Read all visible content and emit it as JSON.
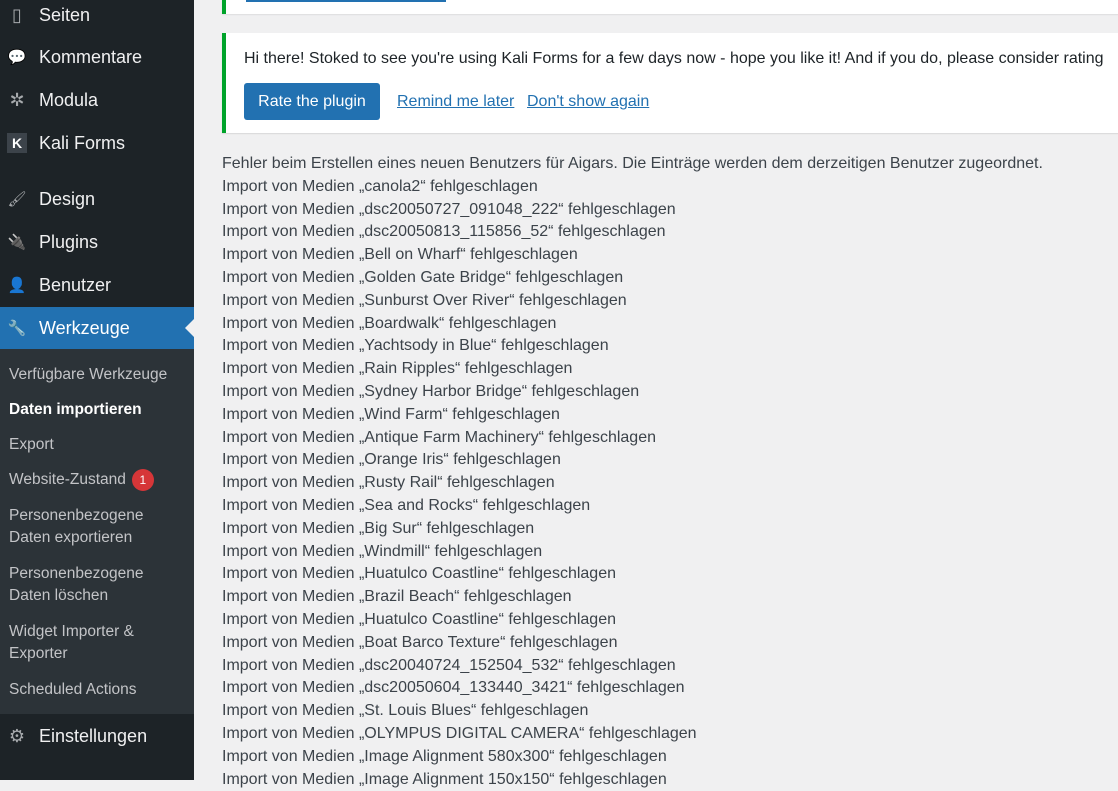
{
  "sidebar": {
    "menu": [
      {
        "label": "Seiten",
        "icon": "pages-icon",
        "glyph": "▯"
      },
      {
        "label": "Kommentare",
        "icon": "comments-icon",
        "glyph": "💬"
      },
      {
        "label": "Modula",
        "icon": "modula-icon",
        "glyph": "✲"
      },
      {
        "label": "Kali Forms",
        "icon": "kali-forms-icon",
        "glyph": "K"
      },
      {
        "label": "Design",
        "icon": "design-brush-icon",
        "glyph": "🖌"
      },
      {
        "label": "Plugins",
        "icon": "plugins-icon",
        "glyph": "🔌"
      },
      {
        "label": "Benutzer",
        "icon": "users-icon",
        "glyph": "👤"
      },
      {
        "label": "Werkzeuge",
        "icon": "wrench-icon",
        "glyph": "🔧"
      },
      {
        "label": "Einstellungen",
        "icon": "settings-icon",
        "glyph": "⚙"
      }
    ],
    "submenu": [
      {
        "label": "Verfügbare Werkzeuge"
      },
      {
        "label": "Daten importieren"
      },
      {
        "label": "Export"
      },
      {
        "label": "Website-Zustand",
        "badge": "1"
      },
      {
        "label": "Personenbezogene\nDaten exportieren"
      },
      {
        "label": "Personenbezogene\nDaten löschen"
      },
      {
        "label": "Widget Importer &\nExporter"
      },
      {
        "label": "Scheduled Actions"
      }
    ]
  },
  "notice": {
    "message": "Hi there! Stoked to see you're using Kali Forms for a few days now - hope you like it! And if you do, please consider rating",
    "rate_button": "Rate the plugin",
    "remind_link": "Remind me later",
    "dismiss_link": "Don't show again"
  },
  "log": [
    "Fehler beim Erstellen eines neuen Benutzers für Aigars. Die Einträge werden dem derzeitigen Benutzer zugeordnet.",
    "Import von Medien „canola2“ fehlgeschlagen",
    "Import von Medien „dsc20050727_091048_222“ fehlgeschlagen",
    "Import von Medien „dsc20050813_115856_52“ fehlgeschlagen",
    "Import von Medien „Bell on Wharf“ fehlgeschlagen",
    "Import von Medien „Golden Gate Bridge“ fehlgeschlagen",
    "Import von Medien „Sunburst Over River“ fehlgeschlagen",
    "Import von Medien „Boardwalk“ fehlgeschlagen",
    "Import von Medien „Yachtsody in Blue“ fehlgeschlagen",
    "Import von Medien „Rain Ripples“ fehlgeschlagen",
    "Import von Medien „Sydney Harbor Bridge“ fehlgeschlagen",
    "Import von Medien „Wind Farm“ fehlgeschlagen",
    "Import von Medien „Antique Farm Machinery“ fehlgeschlagen",
    "Import von Medien „Orange Iris“ fehlgeschlagen",
    "Import von Medien „Rusty Rail“ fehlgeschlagen",
    "Import von Medien „Sea and Rocks“ fehlgeschlagen",
    "Import von Medien „Big Sur“ fehlgeschlagen",
    "Import von Medien „Windmill“ fehlgeschlagen",
    "Import von Medien „Huatulco Coastline“ fehlgeschlagen",
    "Import von Medien „Brazil Beach“ fehlgeschlagen",
    "Import von Medien „Huatulco Coastline“ fehlgeschlagen",
    "Import von Medien „Boat Barco Texture“ fehlgeschlagen",
    "Import von Medien „dsc20040724_152504_532“ fehlgeschlagen",
    "Import von Medien „dsc20050604_133440_3421“ fehlgeschlagen",
    "Import von Medien „St. Louis Blues“ fehlgeschlagen",
    "Import von Medien „OLYMPUS DIGITAL CAMERA“ fehlgeschlagen",
    "Import von Medien „Image Alignment 580x300“ fehlgeschlagen",
    "Import von Medien „Image Alignment 150x150“ fehlgeschlagen"
  ]
}
